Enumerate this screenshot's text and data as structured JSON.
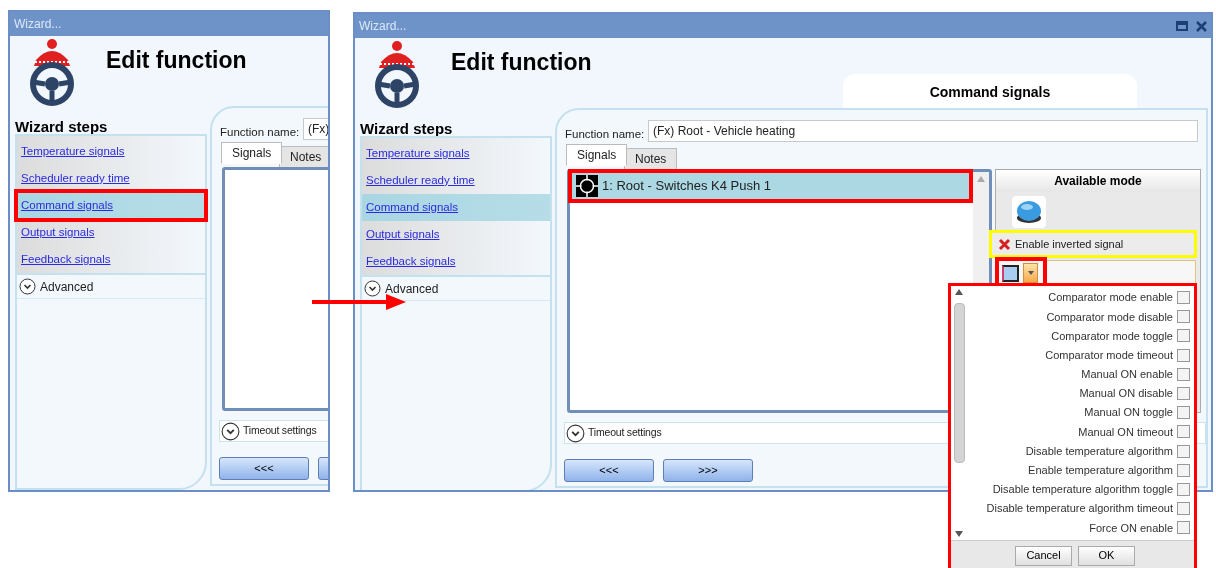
{
  "windows": [
    {
      "title": "Wizard...",
      "heading": "Edit function",
      "steps_title": "Wizard steps",
      "steps": [
        {
          "label": "Temperature signals",
          "selected": false,
          "highlighted": false
        },
        {
          "label": "Scheduler ready time",
          "selected": false,
          "highlighted": false
        },
        {
          "label": "Command signals",
          "selected": true,
          "highlighted": true
        },
        {
          "label": "Output signals",
          "selected": false,
          "highlighted": false
        },
        {
          "label": "Feedback signals",
          "selected": false,
          "highlighted": false
        }
      ],
      "advanced": "Advanced",
      "function_name_label": "Function name:",
      "function_name": "(Fx)",
      "tabs": [
        {
          "label": "Signals",
          "selected": true
        },
        {
          "label": "Notes",
          "selected": false
        }
      ],
      "timeout": "Timeout settings",
      "buttons": [
        "<<<"
      ],
      "cut_button": true
    },
    {
      "title": "Wizard...",
      "heading": "Edit function",
      "section_title": "Command signals",
      "steps_title": "Wizard steps",
      "steps": [
        {
          "label": "Temperature signals",
          "selected": false,
          "highlighted": false
        },
        {
          "label": "Scheduler ready time",
          "selected": false,
          "highlighted": false
        },
        {
          "label": "Command signals",
          "selected": true,
          "highlighted": false
        },
        {
          "label": "Output signals",
          "selected": false,
          "highlighted": false
        },
        {
          "label": "Feedback signals",
          "selected": false,
          "highlighted": false
        }
      ],
      "advanced": "Advanced",
      "function_name_label": "Function name:",
      "function_name": "(Fx) Root - Vehicle heating",
      "tabs": [
        {
          "label": "Signals",
          "selected": true
        },
        {
          "label": "Notes",
          "selected": false
        }
      ],
      "signals": [
        {
          "label": "1: Root - Switches K4 Push 1",
          "selected": true,
          "highlighted": true
        }
      ],
      "available_mode": {
        "title": "Available mode",
        "inverted": {
          "label": "Enable inverted signal",
          "checked": false,
          "highlighted": true
        },
        "picker_highlighted": true
      },
      "timeout": "Timeout settings",
      "buttons": [
        "<<<",
        ">>>"
      ],
      "cut_button": false,
      "popup": {
        "highlighted": true,
        "items": [
          {
            "label": "Comparator mode enable",
            "checked": false
          },
          {
            "label": "Comparator mode disable",
            "checked": false
          },
          {
            "label": "Comparator mode toggle",
            "checked": false
          },
          {
            "label": "Comparator mode timeout",
            "checked": false
          },
          {
            "label": "Manual ON enable",
            "checked": false
          },
          {
            "label": "Manual ON disable",
            "checked": false
          },
          {
            "label": "Manual ON toggle",
            "checked": false
          },
          {
            "label": "Manual ON timeout",
            "checked": false
          },
          {
            "label": "Disable temperature algorithm",
            "checked": false
          },
          {
            "label": "Enable temperature algorithm",
            "checked": false
          },
          {
            "label": "Disable temperature algorithm toggle",
            "checked": false
          },
          {
            "label": "Disable temperature algorithm timeout",
            "checked": false
          },
          {
            "label": "Force ON enable",
            "checked": false
          }
        ],
        "buttons": [
          "Cancel",
          "OK"
        ]
      }
    }
  ]
}
